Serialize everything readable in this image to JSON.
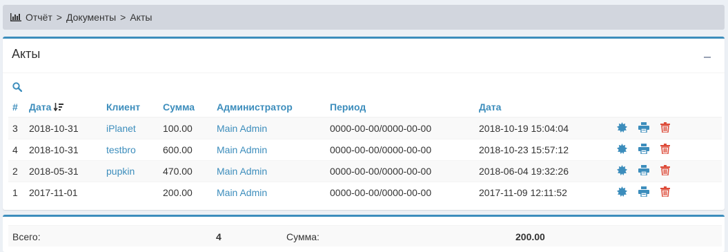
{
  "breadcrumb": {
    "icon": "bar-chart-icon",
    "items": [
      "Отчёт",
      "Документы",
      "Акты"
    ],
    "separator": ">"
  },
  "box": {
    "title": "Акты",
    "collapse_icon": "minus-icon",
    "search_icon": "search-icon"
  },
  "table": {
    "headers": [
      "#",
      "Дата",
      "Клиент",
      "Сумма",
      "Администратор",
      "Период",
      "Дата"
    ],
    "rows": [
      {
        "id": "3",
        "date": "2018-10-31",
        "client": "iPlanet",
        "sum": "100.00",
        "admin": "Main Admin",
        "period": "0000-00-00/0000-00-00",
        "created": "2018-10-19 15:04:04"
      },
      {
        "id": "4",
        "date": "2018-10-31",
        "client": "testbro",
        "sum": "600.00",
        "admin": "Main Admin",
        "period": "0000-00-00/0000-00-00",
        "created": "2018-10-23 15:57:12"
      },
      {
        "id": "2",
        "date": "2018-05-31",
        "client": "pupkin",
        "sum": "470.00",
        "admin": "Main Admin",
        "period": "0000-00-00/0000-00-00",
        "created": "2018-06-04 19:32:26"
      },
      {
        "id": "1",
        "date": "2017-11-01",
        "client": "",
        "sum": "200.00",
        "admin": "Main Admin",
        "period": "0000-00-00/0000-00-00",
        "created": "2017-11-09 12:11:52"
      }
    ],
    "actions": [
      "gear-icon",
      "print-icon",
      "trash-icon"
    ],
    "colors": {
      "link": "#3c8dbc",
      "delete": "#dd4b39",
      "accent": "#3c8dbc"
    }
  },
  "totals": {
    "count_label": "Всего:",
    "count": "4",
    "sum_label": "Сумма:",
    "sum": "200.00"
  }
}
